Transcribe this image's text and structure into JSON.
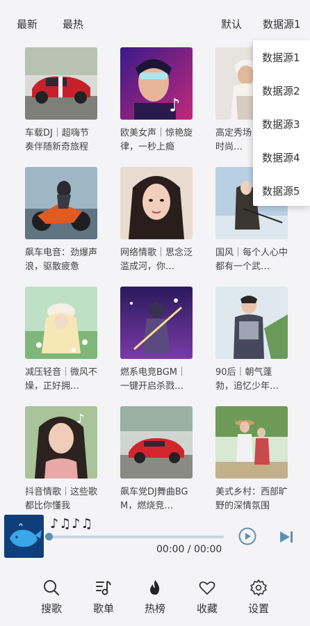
{
  "filters": {
    "newest": "最新",
    "hottest": "最热",
    "default": "默认",
    "source_selected": "数据源1"
  },
  "dropdown": {
    "options": [
      "数据源1",
      "数据源2",
      "数据源3",
      "数据源4",
      "数据源5"
    ]
  },
  "playlists": [
    {
      "title": "车载DJ｜超嗨节奏伴随新奇旅程",
      "cover": "red-sports-car"
    },
    {
      "title": "欧美女声｜惊艳旋律，一秒上瘾",
      "cover": "neon-girl-tiktok"
    },
    {
      "title": "高定秀场｜魅影的时尚…",
      "cover": "fashion-model"
    },
    {
      "title": "飙车电音：劲爆声浪，驱散疲惫",
      "cover": "motorbike-rider"
    },
    {
      "title": "网络情歌｜思念泛滥成河，你…",
      "cover": "girl-portrait"
    },
    {
      "title": "国风｜每个人心中都有一个武…",
      "cover": "wuxia-swordsman"
    },
    {
      "title": "减压轻音｜微风不燥，正好拥…",
      "cover": "anime-flower-girl"
    },
    {
      "title": "燃系电竞BGM｜一键开启杀戮…",
      "cover": "esports-hero"
    },
    {
      "title": "90后｜朝气蓬勃，追忆少年…",
      "cover": "young-man"
    },
    {
      "title": "抖音情歌｜这些歌都比你懂我",
      "cover": "girl-tiktok"
    },
    {
      "title": "飙车党DJ舞曲BGM，燃烧竞…",
      "cover": "red-supercar"
    },
    {
      "title": "美式乡村：西部旷野的深情氛围",
      "cover": "country-couple"
    }
  ],
  "player": {
    "track_title": "♪♫♪♫",
    "time": "00:00 / 00:00",
    "progress": 0,
    "thumb_icon": "whale-logo"
  },
  "nav": [
    {
      "label": "搜歌",
      "icon": "search-icon"
    },
    {
      "label": "歌单",
      "icon": "playlist-icon"
    },
    {
      "label": "热榜",
      "icon": "flame-icon"
    },
    {
      "label": "收藏",
      "icon": "heart-icon"
    },
    {
      "label": "设置",
      "icon": "gear-icon"
    }
  ],
  "colors": {
    "background": "#f4f4f6",
    "accent": "#5e8fb0",
    "progress_track": "#c9d6e0"
  }
}
